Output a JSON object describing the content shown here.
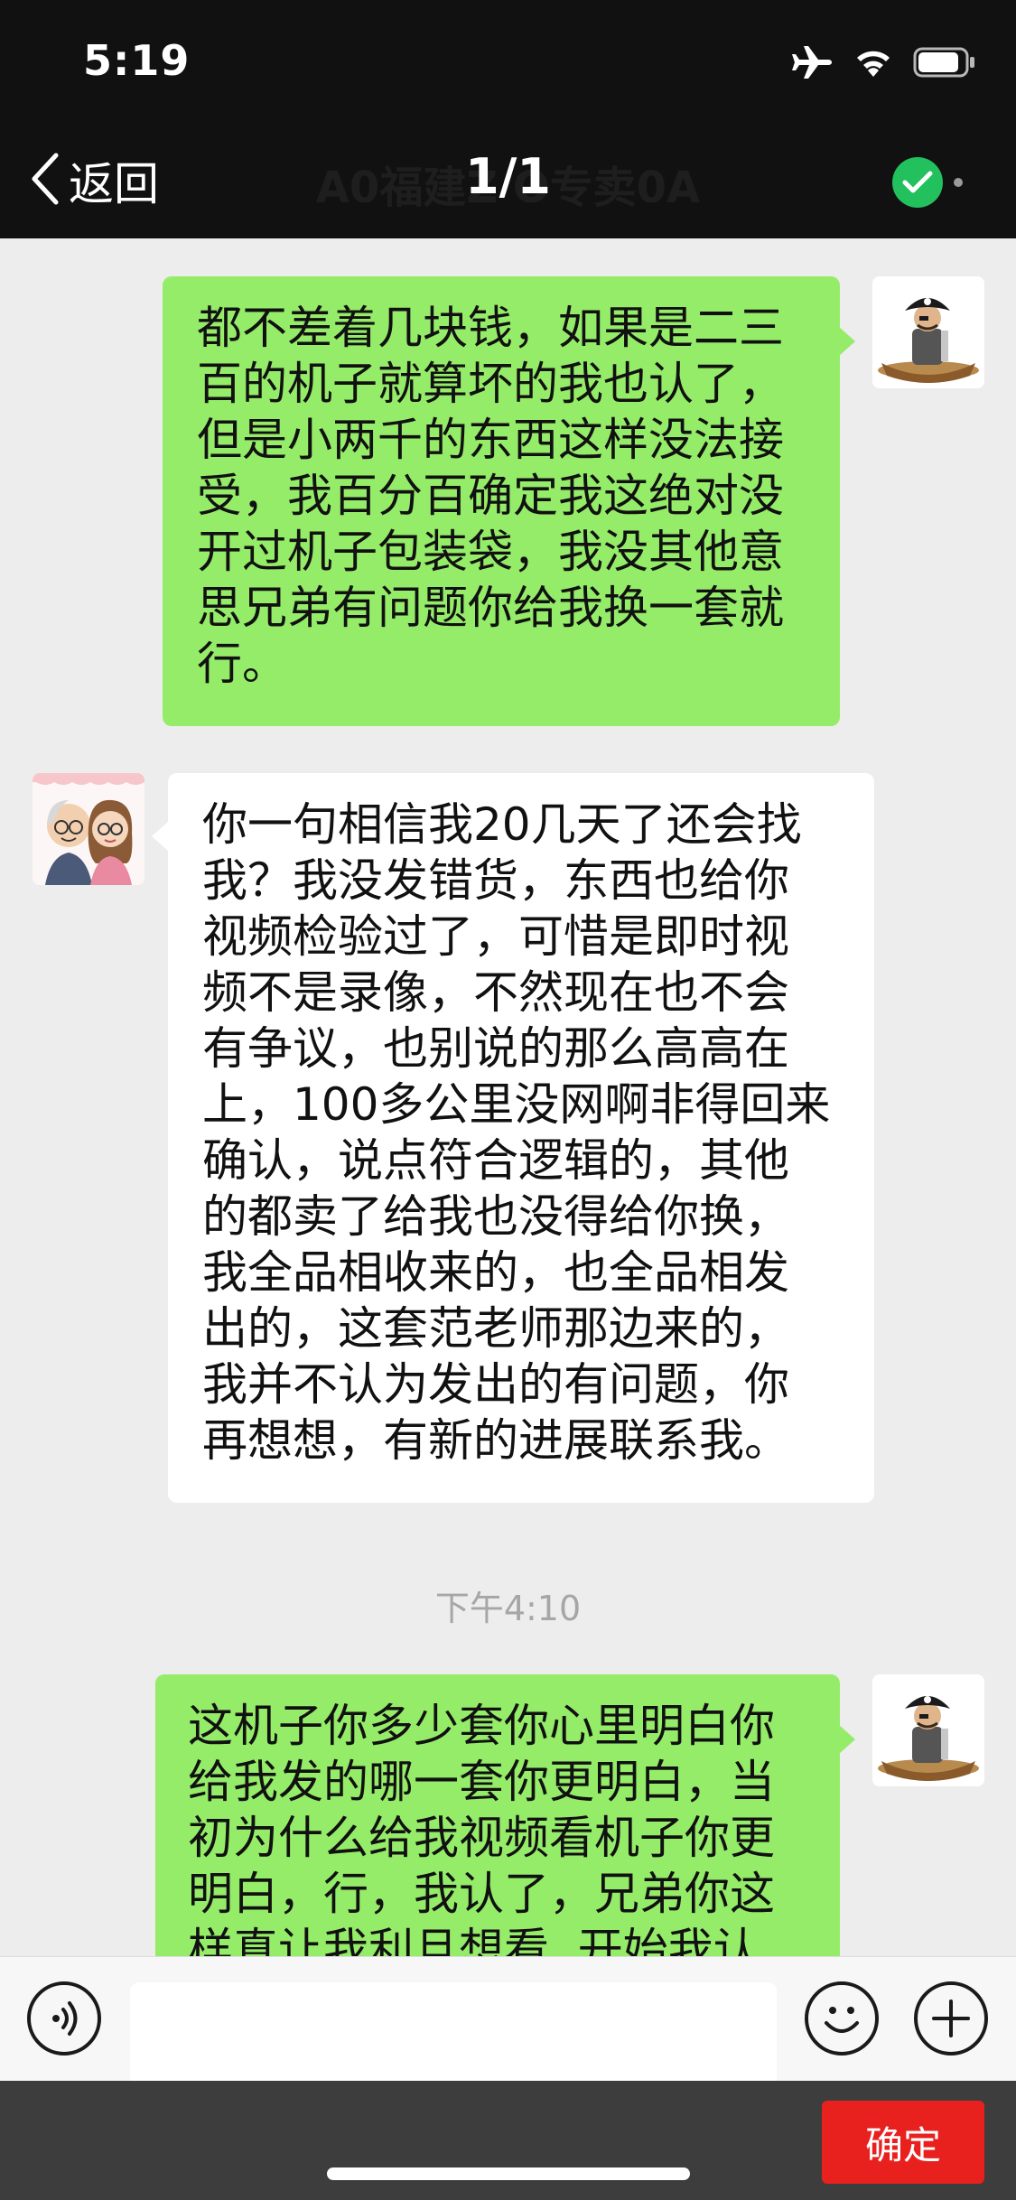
{
  "status_bar": {
    "time": "5:19"
  },
  "nav": {
    "back_label": "返回",
    "title_background": "A0福建Z     O专卖0A",
    "title": "1/1"
  },
  "messages": [
    {
      "side": "me",
      "text": "都不差着几块钱，如果是二三\n百的机子就算坏的我也认了，\n但是小两千的东西这样没法接\n受，我百分百确定我这绝对没\n开过机子包装袋，我没其他意\n思兄弟有问题你给我换一套就\n行。"
    },
    {
      "side": "them",
      "text": "你一句相信我20几天了还会找\n我？我没发错货，东西也给你\n视频检验过了，可惜是即时视\n频不是录像，不然现在也不会\n有争议，也别说的那么高高在\n上，100多公里没网啊非得回来\n确认，说点符合逻辑的，其他\n的都卖了给我也没得给你换，\n我全品相收来的，也全品相发\n出的，这套范老师那边来的，\n我并不认为发出的有问题，你\n再想想，有新的进展联系我。"
    },
    {
      "side": "me",
      "text": "这机子你多少套你心里明白你\n给我发的哪一套你更明白，当\n初为什么给我视频看机子你更\n明白，行，我认了，兄弟你这\n样真让我利旦想看  开始我认"
    }
  ],
  "timestamp": "下午4:10",
  "input": {
    "value": ""
  },
  "confirm_label": "确定",
  "colors": {
    "my_bubble": "#95ec69",
    "their_bubble": "#ffffff",
    "confirm": "#e8211f",
    "verified": "#22c15e"
  },
  "icons": [
    "back-chevron-icon",
    "airplane-icon",
    "wifi-icon",
    "battery-icon",
    "verified-check-icon",
    "voice-icon",
    "emoji-icon",
    "plus-icon"
  ]
}
